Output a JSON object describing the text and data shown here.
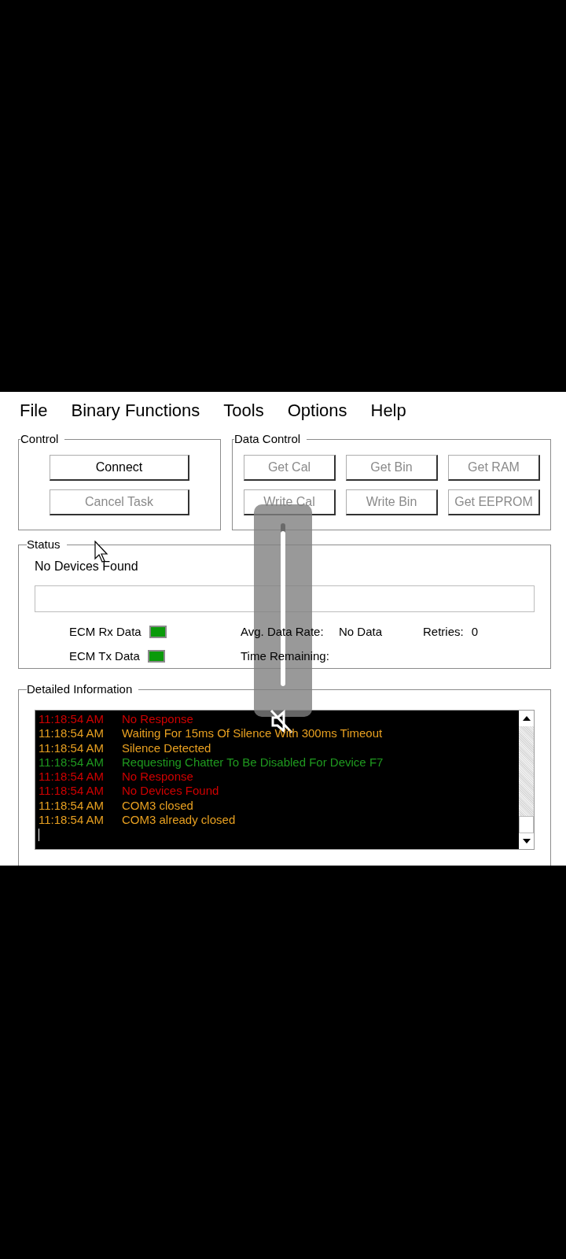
{
  "menu": [
    "File",
    "Binary Functions",
    "Tools",
    "Options",
    "Help"
  ],
  "control": {
    "title": "Control",
    "buttons": [
      {
        "label": "Connect",
        "disabled": false
      },
      {
        "label": "Cancel Task",
        "disabled": true
      }
    ]
  },
  "data_control": {
    "title": "Data Control",
    "buttons": [
      {
        "label": "Get Cal",
        "disabled": true
      },
      {
        "label": "Get Bin",
        "disabled": true
      },
      {
        "label": "Get RAM",
        "disabled": true
      },
      {
        "label": "Write Cal",
        "disabled": true
      },
      {
        "label": "Write Bin",
        "disabled": true
      },
      {
        "label": "Get EEPROM",
        "disabled": true
      }
    ]
  },
  "status": {
    "title": "Status",
    "message": "No Devices Found",
    "indicators": [
      {
        "label": "ECM Rx Data",
        "lit": true
      },
      {
        "label": "ECM Tx Data",
        "lit": true
      }
    ],
    "avg_rate_label": "Avg. Data Rate:",
    "avg_rate_value": "No Data",
    "retries_label": "Retries:",
    "retries_value": "0",
    "time_remaining_label": "Time Remaining:"
  },
  "detailed": {
    "title": "Detailed Information",
    "log": [
      {
        "time": "11:18:54 AM",
        "message": "No Response",
        "color": "#d00000"
      },
      {
        "time": "11:18:54 AM",
        "message": "Waiting For 15ms Of Silence With 300ms Timeout",
        "color": "#e8a020"
      },
      {
        "time": "11:18:54 AM",
        "message": "Silence Detected",
        "color": "#e8a020"
      },
      {
        "time": "11:18:54 AM",
        "message": "Requesting Chatter To Be Disabled For Device F7",
        "color": "#1f9a1f"
      },
      {
        "time": "11:18:54 AM",
        "message": "No Response",
        "color": "#d00000"
      },
      {
        "time": "11:18:54 AM",
        "message": "No Devices Found",
        "color": "#d00000"
      },
      {
        "time": "11:18:54 AM",
        "message": "COM3 closed",
        "color": "#e8a020"
      },
      {
        "time": "11:18:54 AM",
        "message": "COM3 already closed",
        "color": "#e8a020"
      }
    ]
  },
  "volume_overlay": {
    "level": 0.95,
    "muted": true
  }
}
